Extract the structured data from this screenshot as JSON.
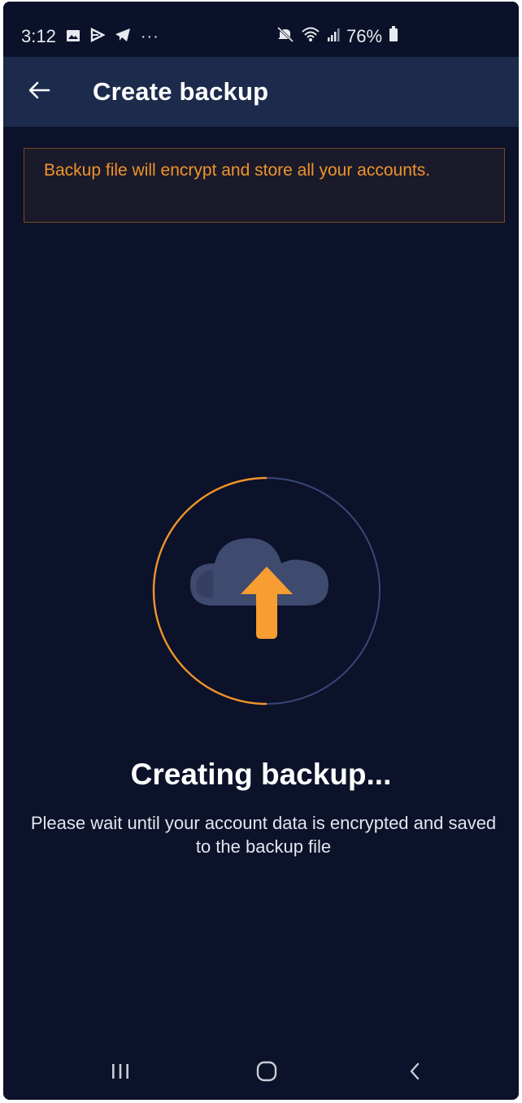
{
  "status_bar": {
    "time": "3:12",
    "dots": "···",
    "battery": "76%",
    "icons": [
      "gallery-icon",
      "play-store-icon",
      "telegram-icon",
      "mute-icon",
      "wifi-icon",
      "signal-icon",
      "battery-icon"
    ]
  },
  "app_bar": {
    "title": "Create backup",
    "back_icon": "back-arrow-icon"
  },
  "notice": {
    "text": "Backup file will encrypt and store all your accounts."
  },
  "progress": {
    "icon": "cloud-upload-icon",
    "value": 0.5
  },
  "content": {
    "title": "Creating backup...",
    "message": "Please wait until your account data is encrypted and saved to the backup file"
  },
  "nav_bar": {
    "items": [
      "recent-apps-icon",
      "home-icon",
      "back-icon"
    ]
  },
  "colors": {
    "background": "#0b1229",
    "app_bar": "#1c2a4b",
    "accent": "#f0932b",
    "ring_track": "#3a4677",
    "cloud": "#3e4a6e"
  }
}
